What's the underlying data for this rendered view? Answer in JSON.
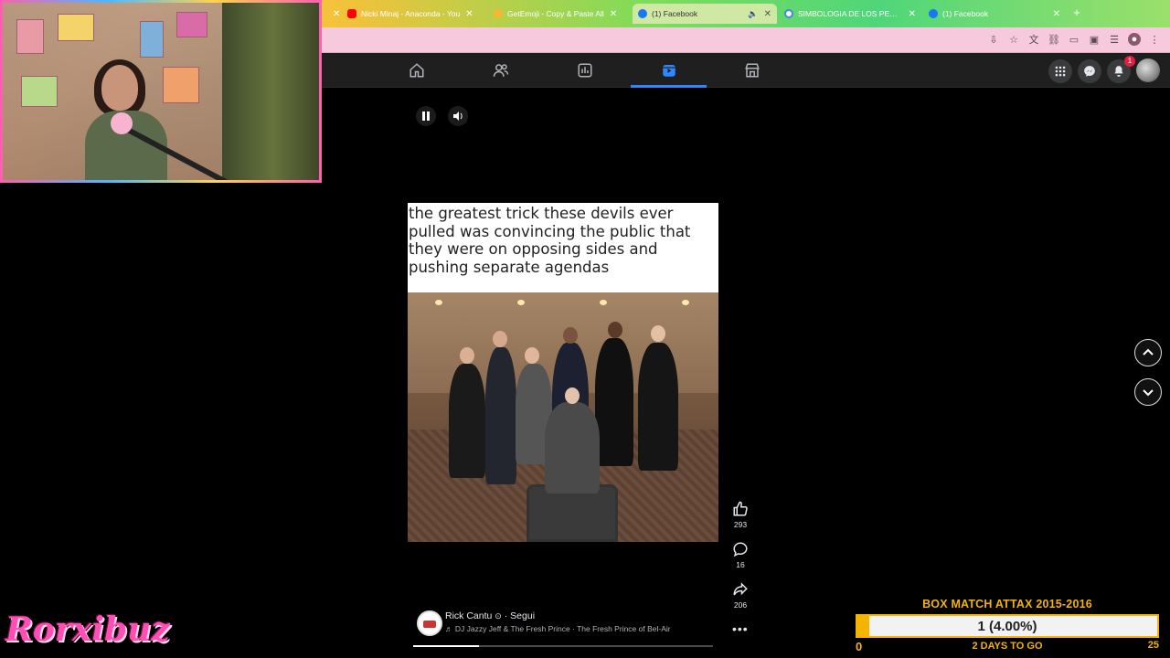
{
  "browser": {
    "tabs": [
      {
        "label": "Nicki Minaj - Anaconda - You",
        "favicon": "youtube-icon",
        "color": "#ff0000",
        "active": false
      },
      {
        "label": "GetEmoji - Copy & Paste All",
        "favicon": "emoji-icon",
        "color": "#f7b731",
        "active": false
      },
      {
        "label": "(1) Facebook",
        "favicon": "facebook-icon",
        "color": "#1877f2",
        "active": true
      },
      {
        "label": "SIMBOLOGIA DE LOS PEDOI",
        "favicon": "google-icon",
        "color": "#4285f4",
        "active": false
      },
      {
        "label": "(1) Facebook",
        "favicon": "facebook-icon",
        "color": "#1877f2",
        "active": false
      }
    ],
    "new_tab": "+"
  },
  "facebook": {
    "nav": [
      "home-icon",
      "friends-icon",
      "feeds-icon",
      "reels-icon",
      "marketplace-icon"
    ],
    "active_nav": "reels-icon",
    "notification_count": "1",
    "accent": "#2d88ff"
  },
  "reel": {
    "caption_text": "the greatest trick these devils ever pulled was convincing the public that they were on opposing sides and pushing separate agendas",
    "likes": "293",
    "comments": "16",
    "shares": "206",
    "author": "Rick Cantu",
    "follow": "Segui",
    "song": "DJ Jazzy Jeff & The Fresh Prince · The Fresh Prince of Bel-Air",
    "progress": 0.22
  },
  "overlay": {
    "brand": "Rorxibuz",
    "goal": {
      "title": "BOX MATCH ATTAX 2015-2016",
      "value": "1 (4.00%)",
      "fraction": 0.04,
      "min": "0",
      "max": "25",
      "days": "2 DAYS TO GO",
      "color": "#f5b400"
    }
  }
}
